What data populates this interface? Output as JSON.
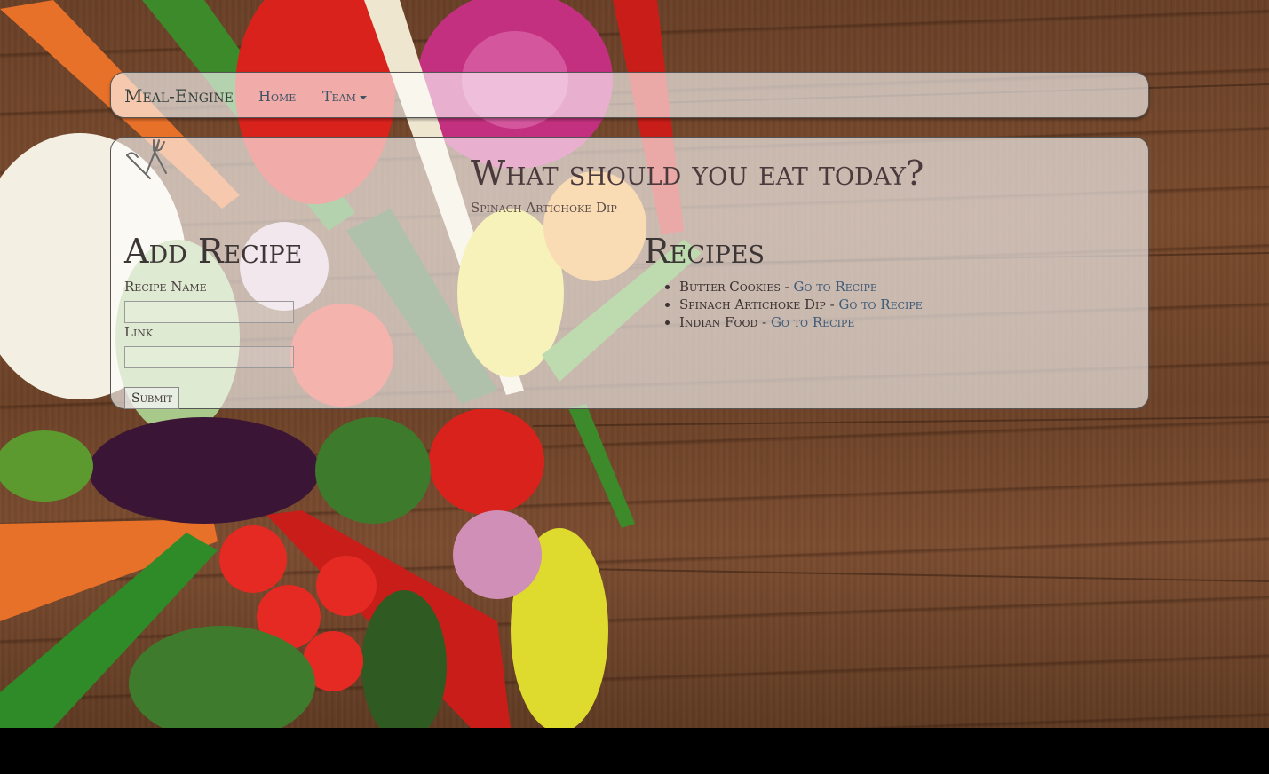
{
  "navbar": {
    "brand": "Meal-Engine",
    "items": [
      {
        "label": "Home"
      },
      {
        "label": "Team",
        "has_dropdown": true
      }
    ]
  },
  "hero": {
    "question": "What should you eat today?",
    "suggestion": "Spinach Artichoke Dip"
  },
  "add_recipe": {
    "heading": "Add Recipe",
    "name_label": "Recipe Name",
    "name_value": "",
    "link_label": "Link",
    "link_value": "",
    "submit_label": "Submit"
  },
  "recipes": {
    "heading": "Recipes",
    "items": [
      {
        "name": "Butter Cookies",
        "separator": " - ",
        "link_label": "Go to Recipe"
      },
      {
        "name": "Spinach Artichoke Dip",
        "separator": " - ",
        "link_label": "Go to Recipe"
      },
      {
        "name": "Indian Food",
        "separator": " - ",
        "link_label": "Go to Recipe"
      }
    ]
  },
  "icons": {
    "logo": "fork-knife-icon",
    "dropdown": "caret-down-icon"
  },
  "colors": {
    "link": "#3f5b77",
    "panel": "rgba(255,255,255,0.62)",
    "footer_bar": "#000000"
  }
}
